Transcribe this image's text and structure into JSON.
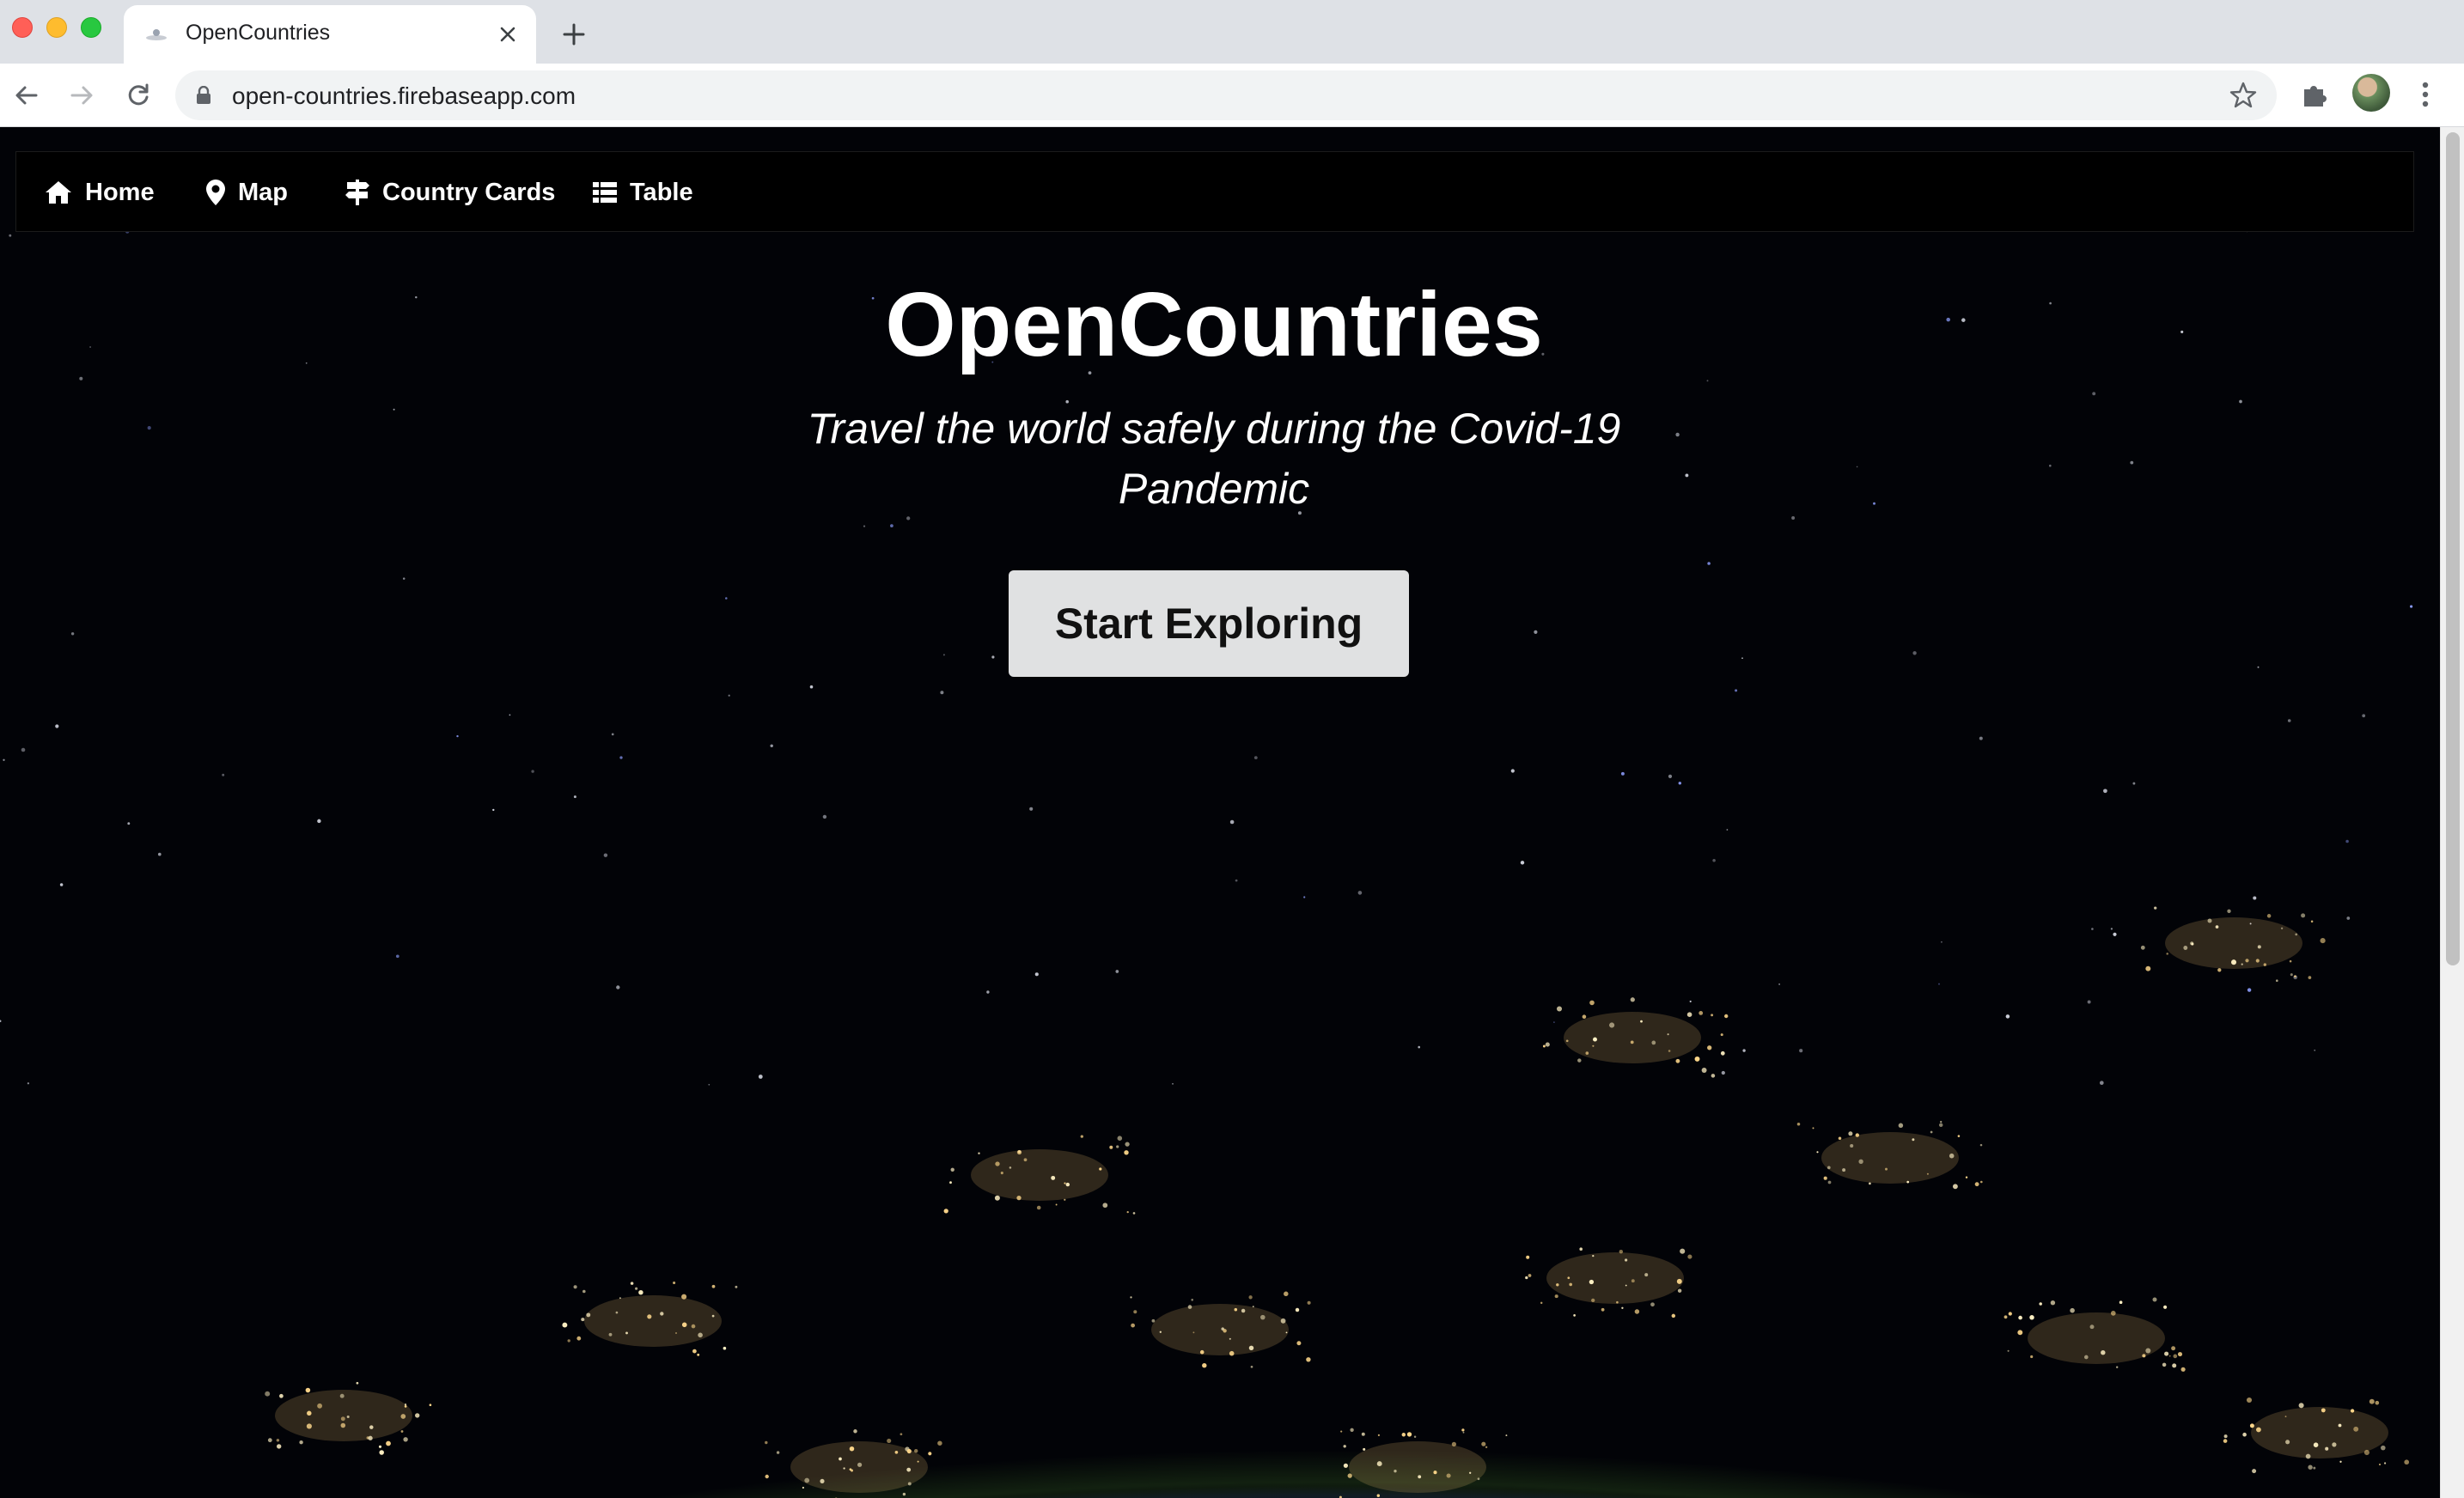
{
  "browser": {
    "tab_title": "OpenCountries",
    "url": "open-countries.firebaseapp.com"
  },
  "site_nav": {
    "items": [
      {
        "label": "Home",
        "icon": "home-icon"
      },
      {
        "label": "Map",
        "icon": "map-marker-icon"
      },
      {
        "label": "Country Cards",
        "icon": "signpost-icon"
      },
      {
        "label": "Table",
        "icon": "table-list-icon"
      }
    ]
  },
  "hero": {
    "title": "OpenCountries",
    "subtitle": "Travel the world safely during the Covid-19 Pandemic",
    "cta_label": "Start Exploring"
  }
}
